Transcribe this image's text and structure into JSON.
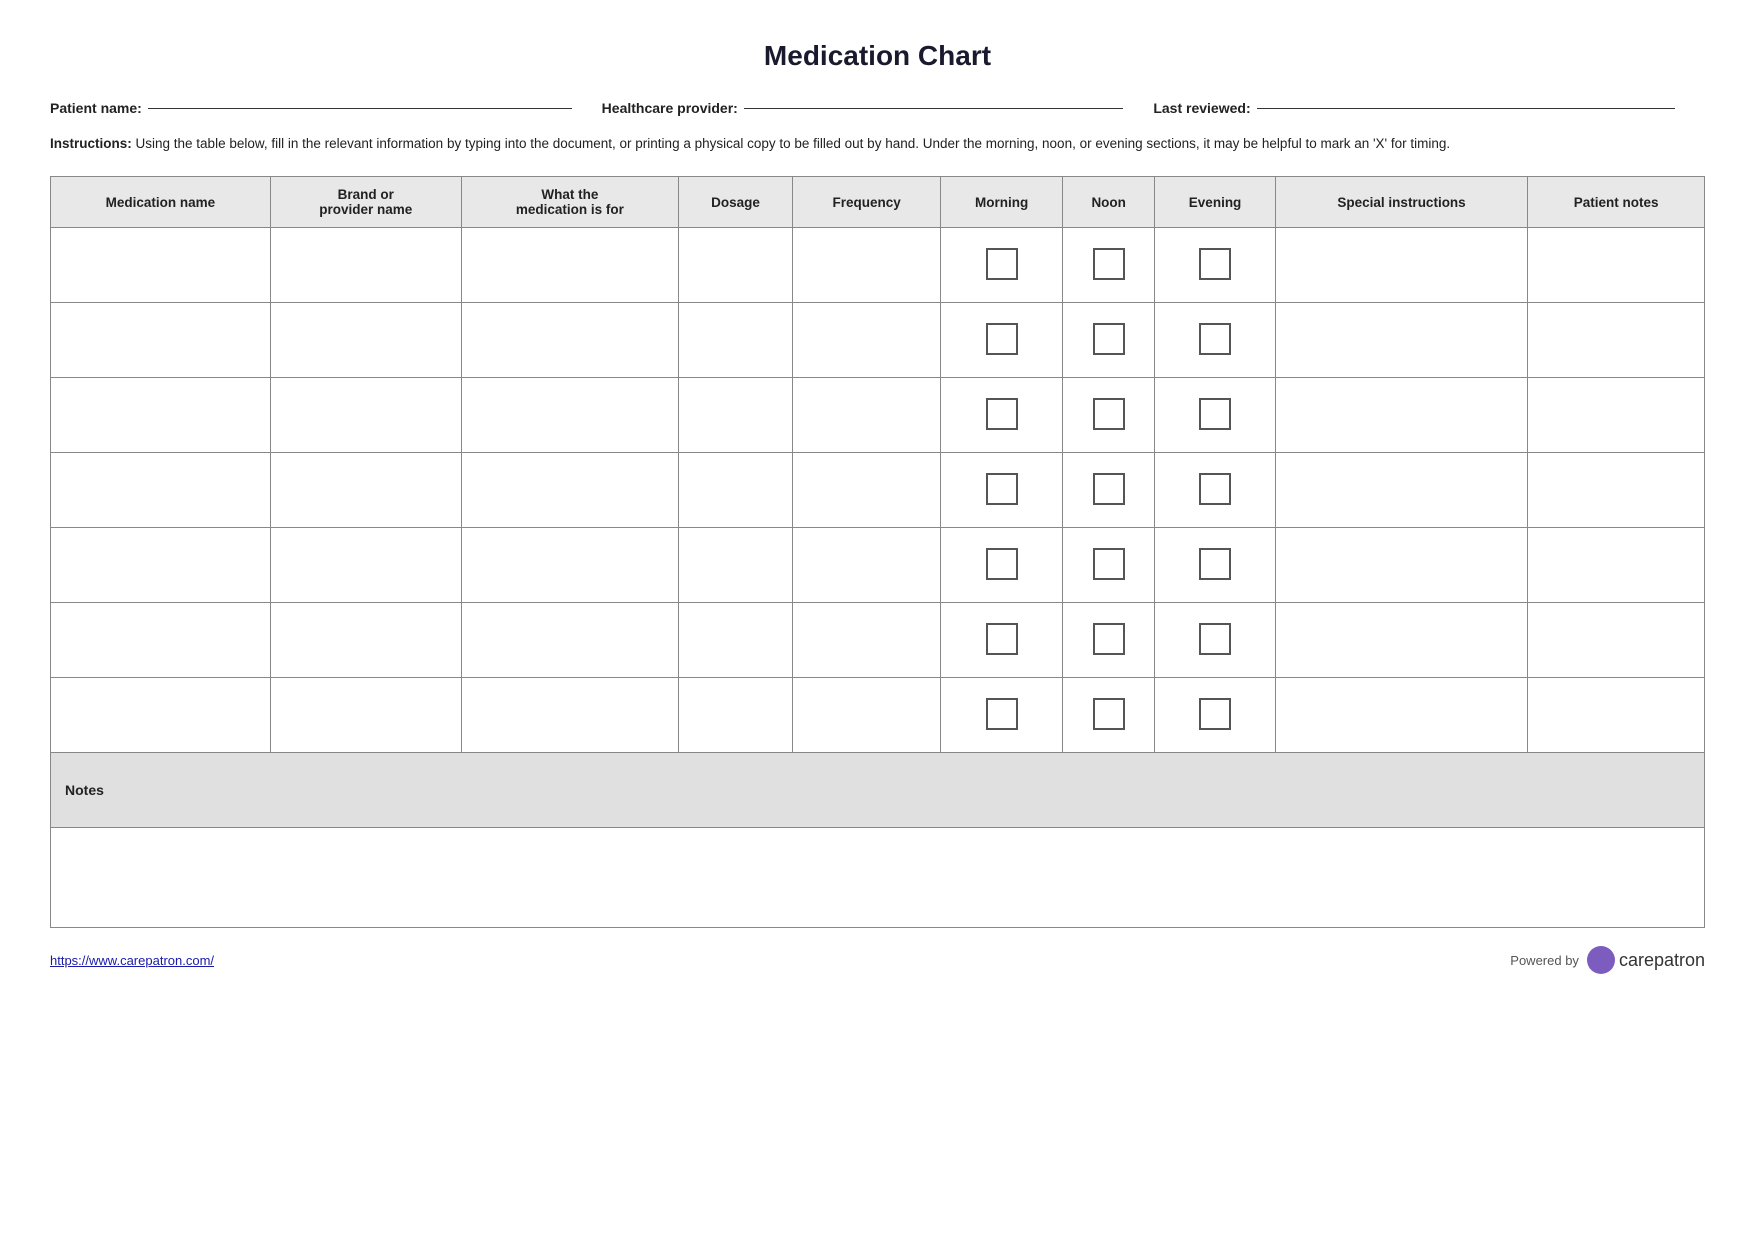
{
  "page": {
    "title": "Medication Chart"
  },
  "patient_info": {
    "patient_name_label": "Patient name:",
    "healthcare_provider_label": "Healthcare provider:",
    "last_reviewed_label": "Last reviewed:"
  },
  "instructions": {
    "label": "Instructions:",
    "text": " Using the table below, fill in the relevant information by typing into the document, or printing a physical copy to be filled out by hand. Under the morning, noon, or evening sections, it may be helpful to mark an 'X' for timing."
  },
  "table": {
    "headers": [
      "Medication name",
      "Brand or provider name",
      "What the medication is for",
      "Dosage",
      "Frequency",
      "Morning",
      "Noon",
      "Evening",
      "Special instructions",
      "Patient notes"
    ],
    "rows": 7,
    "notes_label": "Notes"
  },
  "footer": {
    "link_text": "https://www.carepatron.com/",
    "link_href": "https://www.carepatron.com/",
    "powered_by": "Powered by",
    "brand": "care",
    "brand_suffix": "patron"
  }
}
